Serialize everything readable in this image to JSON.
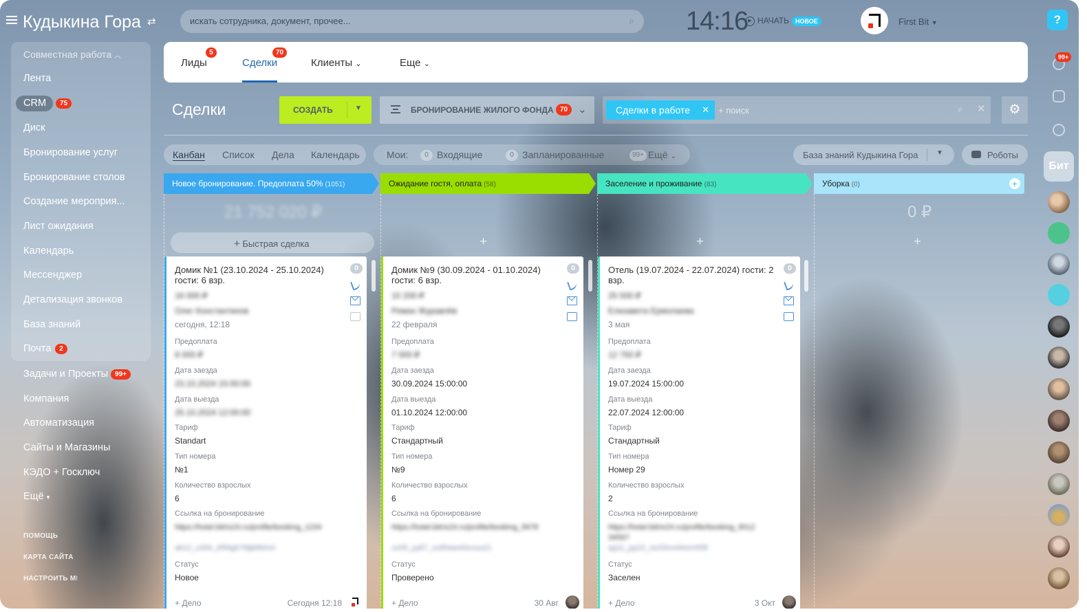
{
  "header": {
    "portal_name": "Кудыкина Гора",
    "search_placeholder": "искать сотрудника, документ, прочее...",
    "clock": "14:16",
    "start_label": "НАЧАТЬ",
    "new_badge": "НОВОЕ",
    "user_name": "First Bit",
    "help_label": "?"
  },
  "menu": {
    "section": "Совместная работа",
    "items": [
      {
        "label": "Лента"
      },
      {
        "label": "CRM",
        "count": "75"
      },
      {
        "label": "Диск"
      },
      {
        "label": "Бронирование услуг"
      },
      {
        "label": "Бронирование столов"
      },
      {
        "label": "Создание мероприя..."
      },
      {
        "label": "Лист ожидания"
      },
      {
        "label": "Календарь"
      },
      {
        "label": "Мессенджер"
      },
      {
        "label": "Детализация звонков"
      },
      {
        "label": "База знаний"
      },
      {
        "label": "Почта",
        "count": "2"
      },
      {
        "label": "Задачи и Проекты",
        "count": "99+"
      },
      {
        "label": "Компания"
      },
      {
        "label": "Автоматизация"
      },
      {
        "label": "Сайты и Магазины"
      },
      {
        "label": "КЭДО + Госключ"
      },
      {
        "label": "Ещё"
      }
    ],
    "footer": [
      "ПОМОЩЬ",
      "КАРТА САЙТА",
      "НАСТРОИТЬ МЕНЮ"
    ]
  },
  "tabs": [
    {
      "label": "Лиды",
      "badge": "5"
    },
    {
      "label": "Сделки",
      "badge": "70"
    },
    {
      "label": "Клиенты"
    },
    {
      "label": "Еще"
    }
  ],
  "toolbar": {
    "title": "Сделки",
    "create_label": "СОЗДАТЬ",
    "category_label": "БРОНИРОВАНИЕ ЖИЛОГО ФОНДА",
    "category_count": "70",
    "filter_chip": "Сделки в работе",
    "search_placeholder": "+ поиск"
  },
  "views": {
    "items": [
      "Канбан",
      "Список",
      "Дела",
      "Календарь"
    ],
    "mine_label": "Мои:",
    "inbox": "Входящие",
    "planned": "Запланированные",
    "more": "Ещё",
    "inbox_count": "0",
    "planned_count": "0",
    "more_count": "99+",
    "kb_label": "База знаний Кудыкина Гора",
    "robots_label": "Роботы"
  },
  "stages": [
    {
      "name": "Новое бронирование. Предоплата 50%",
      "count": "(1051)",
      "sum": "21 752 020 ₽",
      "color": "#39a8ef"
    },
    {
      "name": "Ожидание гостя, оплата",
      "count": "(58)",
      "sum": "",
      "color": "#9ade00"
    },
    {
      "name": "Заселение и проживание",
      "count": "(83)",
      "sum": "",
      "color": "#47e4c2"
    },
    {
      "name": "Уборка",
      "count": "(0)",
      "sum": "0 ₽",
      "color": "#a8e4fa"
    }
  ],
  "quick_deal": "Быстрая сделка",
  "labels": {
    "prepay": "Предоплата",
    "checkin": "Дата заезда",
    "checkout": "Дата выезда",
    "tariff": "Тариф",
    "room_type": "Тип номера",
    "adults": "Количество взрослых",
    "link": "Ссылка на бронирование",
    "status": "Статус",
    "add_task": "+ Дело"
  },
  "cards": [
    {
      "title": "Домик №1 (23.10.2024 - 25.10.2024) гости: 6 взр.",
      "badge": "0",
      "date": "сегодня, 12:18",
      "tariff": "Standart",
      "room": "№1",
      "adults": "6",
      "status": "Новое",
      "footer_date": "Сегодня 12:18"
    },
    {
      "title": "Домик №9 (30.09.2024 - 01.10.2024) гости: 6 взр.",
      "badge": "0",
      "date": "22 февраля",
      "checkin": "30.09.2024 15:00:00",
      "checkout": "01.10.2024 12:00:00",
      "tariff": "Стандартный",
      "room": "№9",
      "adults": "6",
      "status": "Проверено",
      "footer_date": "30 Авг"
    },
    {
      "title": "Отель (19.07.2024 - 22.07.2024) гости: 2 взр.",
      "badge": "0",
      "date": "3 мая",
      "checkin": "19.07.2024 15:00:00",
      "checkout": "22.07.2024 12:00:00",
      "tariff": "Стандартный",
      "room": "Номер 29",
      "adults": "2",
      "status": "Заселен",
      "footer_date": "3 Окт"
    }
  ],
  "rail": {
    "count": "99+",
    "bit_label": "Бит"
  }
}
